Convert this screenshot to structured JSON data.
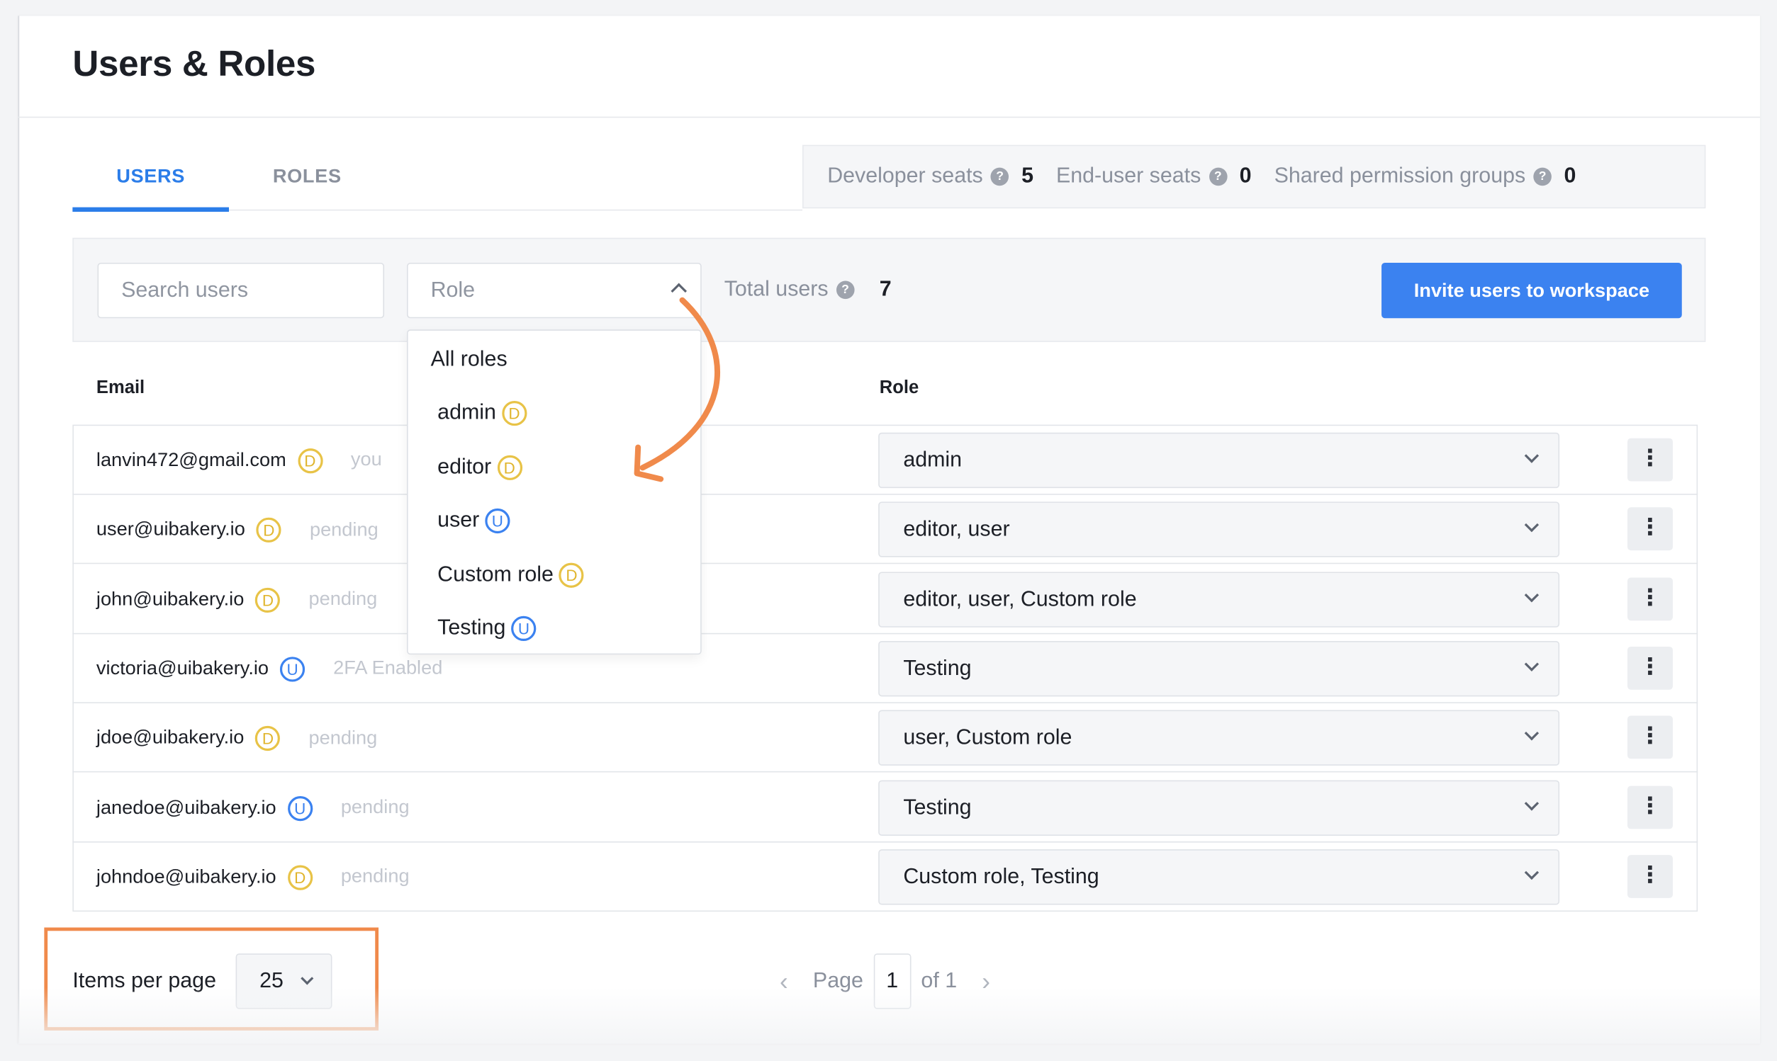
{
  "page": {
    "title": "Users & Roles"
  },
  "tabs": [
    {
      "label": "USERS",
      "active": true
    },
    {
      "label": "ROLES",
      "active": false
    }
  ],
  "seats": {
    "developer_label": "Developer seats",
    "developer_value": "5",
    "enduser_label": "End-user seats",
    "enduser_value": "0",
    "shared_label": "Shared permission groups",
    "shared_value": "0",
    "help_glyph": "?"
  },
  "filters": {
    "search_placeholder": "Search users",
    "role_placeholder": "Role",
    "total_label": "Total users",
    "total_value": "7",
    "invite_label": "Invite users to workspace"
  },
  "table": {
    "headers": {
      "email": "Email",
      "role": "Role"
    },
    "rows": [
      {
        "email": "lanvin472@gmail.com",
        "badge": "D",
        "status": "you",
        "role": "admin"
      },
      {
        "email": "user@uibakery.io",
        "badge": "D",
        "status": "pending",
        "role": "editor, user"
      },
      {
        "email": "john@uibakery.io",
        "badge": "D",
        "status": "pending",
        "role": "editor, user, Custom role"
      },
      {
        "email": "victoria@uibakery.io",
        "badge": "U",
        "status": "2FA Enabled",
        "role": "Testing"
      },
      {
        "email": "jdoe@uibakery.io",
        "badge": "D",
        "status": "pending",
        "role": "user, Custom role"
      },
      {
        "email": "janedoe@uibakery.io",
        "badge": "U",
        "status": "pending",
        "role": "Testing"
      },
      {
        "email": "johndoe@uibakery.io",
        "badge": "D",
        "status": "pending",
        "role": "Custom role, Testing"
      }
    ],
    "row_menu_glyph": "⋮"
  },
  "role_dropdown": {
    "options": [
      {
        "label": "All roles",
        "badge": ""
      },
      {
        "label": "admin",
        "badge": "D"
      },
      {
        "label": "editor",
        "badge": "D"
      },
      {
        "label": "user",
        "badge": "U"
      },
      {
        "label": "Custom role",
        "badge": "D"
      },
      {
        "label": "Testing",
        "badge": "U"
      }
    ]
  },
  "pagination": {
    "items_per_page_label": "Items per page",
    "items_per_page_value": "25",
    "page_label": "Page",
    "current_page": "1",
    "of_label": "of 1",
    "prev_glyph": "‹",
    "next_glyph": "›"
  },
  "colors": {
    "accent": "#3b82f0",
    "developer_badge": "#e8c347",
    "enduser_badge": "#3b82f0",
    "annotation": "#f08a4b"
  }
}
